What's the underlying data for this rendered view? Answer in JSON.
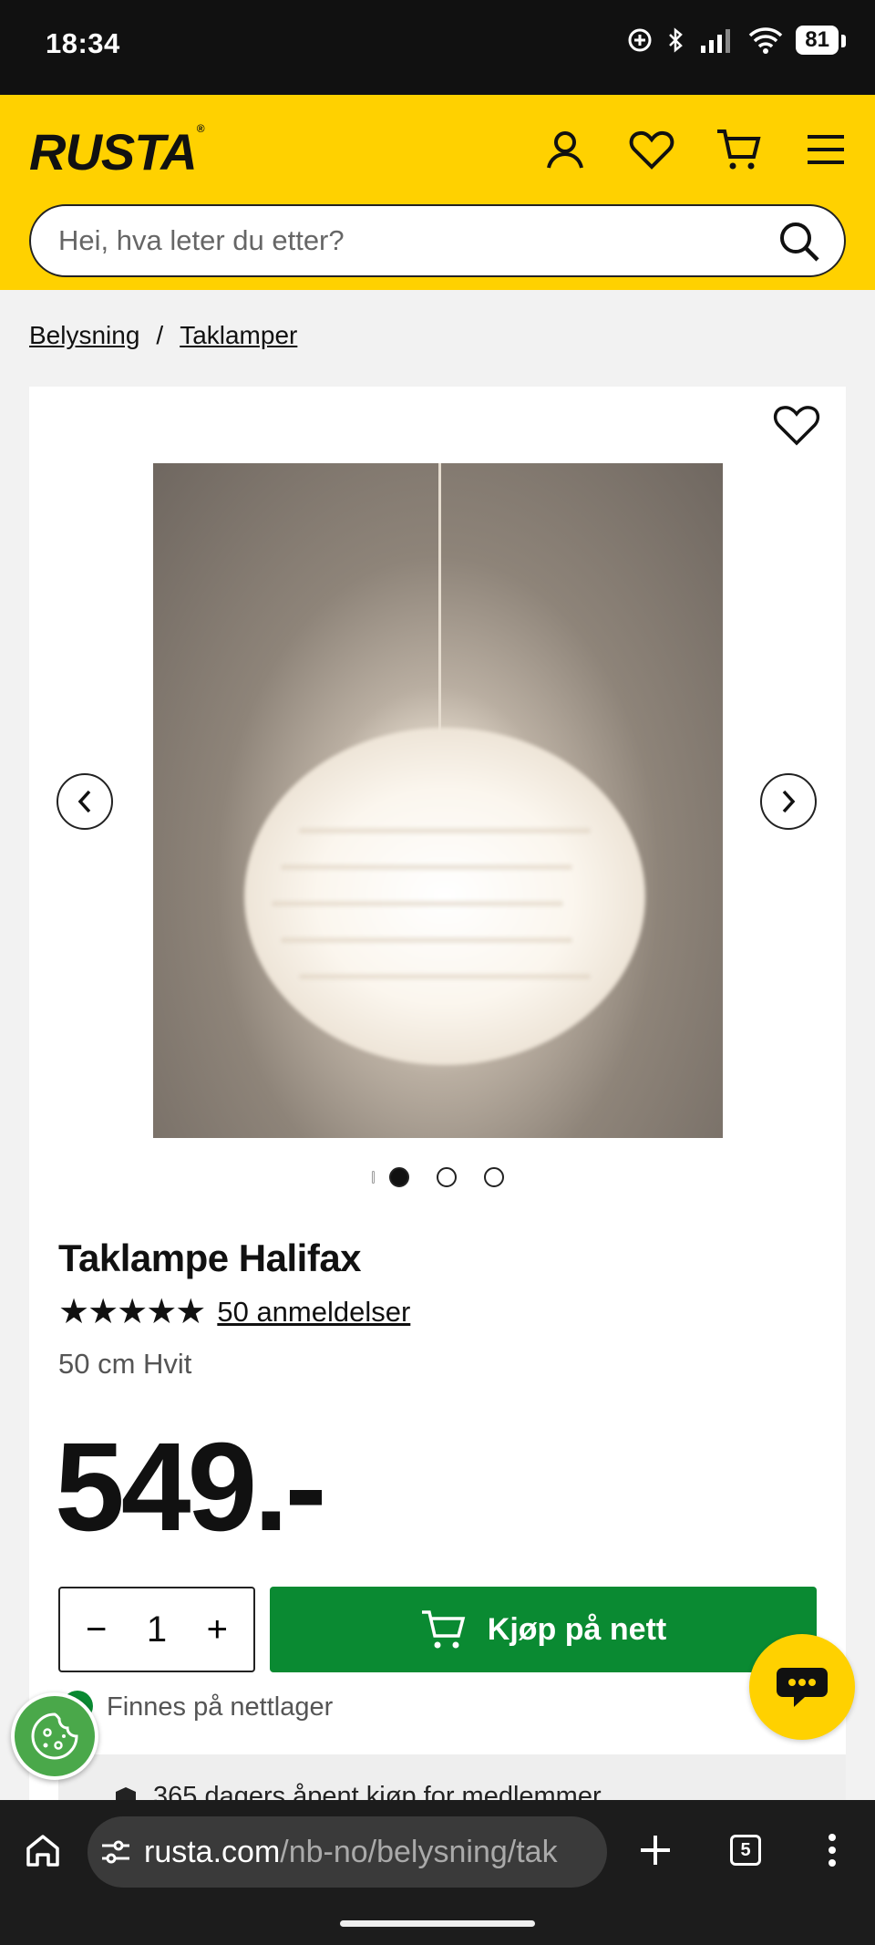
{
  "status_bar": {
    "time": "18:34",
    "battery": "81"
  },
  "header": {
    "logo": "RUSTA",
    "search_placeholder": "Hei, hva leter du etter?"
  },
  "breadcrumb": {
    "items": [
      "Belysning",
      "Taklamper"
    ],
    "separator": "/"
  },
  "product": {
    "title": "Taklampe Halifax",
    "stars": "★★★★★",
    "rating_value": 5,
    "reviews_link": "50 anmeldelser",
    "variant": "50 cm Hvit",
    "price": "549.-",
    "quantity": "1",
    "qty_minus": "−",
    "qty_plus": "+",
    "buy_label": "Kjøp på nett",
    "stock_text": "Finnes på nettlager",
    "info_text": "365 dagers åpent kjøp for medlemmer",
    "image_count": 3,
    "active_image": 1
  },
  "browser": {
    "url_host": "rusta.com",
    "url_path": "/nb-no/belysning/tak",
    "tab_count": "5"
  },
  "colors": {
    "brand_yellow": "#ffd100",
    "buy_green": "#0a8a32"
  }
}
